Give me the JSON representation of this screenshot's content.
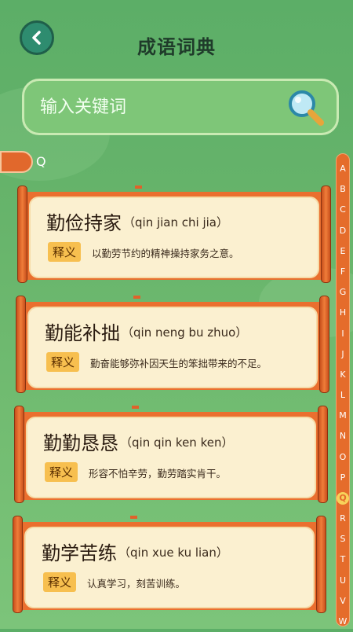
{
  "header": {
    "title": "成语词典",
    "back_icon": "chevron-left-icon"
  },
  "search": {
    "placeholder": "输入关键词",
    "icon": "magnifier-icon"
  },
  "current_letter": "Q",
  "alphabet": [
    "A",
    "B",
    "C",
    "D",
    "E",
    "F",
    "G",
    "H",
    "I",
    "J",
    "K",
    "L",
    "M",
    "N",
    "O",
    "P",
    "Q",
    "R",
    "S",
    "T",
    "U",
    "V",
    "W"
  ],
  "active_letter": "Q",
  "colors": {
    "accent": "#e56c2b",
    "card": "#fbf0d0",
    "tag": "#f7bf4f",
    "background": "#6bb56c"
  },
  "idioms": [
    {
      "word": "勤俭持家",
      "pinyin": "（qin jian chi jia）",
      "tag": "释义",
      "meaning": "以勤劳节约的精神操持家务之意。"
    },
    {
      "word": "勤能补拙",
      "pinyin": "（qin neng bu zhuo）",
      "tag": "释义",
      "meaning": "勤奋能够弥补因天生的笨拙带来的不足。"
    },
    {
      "word": "勤勤恳恳",
      "pinyin": "（qin qin ken ken）",
      "tag": "释义",
      "meaning": "形容不怕辛劳，勤劳踏实肯干。"
    },
    {
      "word": "勤学苦练",
      "pinyin": "（qin xue ku lian）",
      "tag": "释义",
      "meaning": "认真学习，刻苦训练。"
    }
  ]
}
